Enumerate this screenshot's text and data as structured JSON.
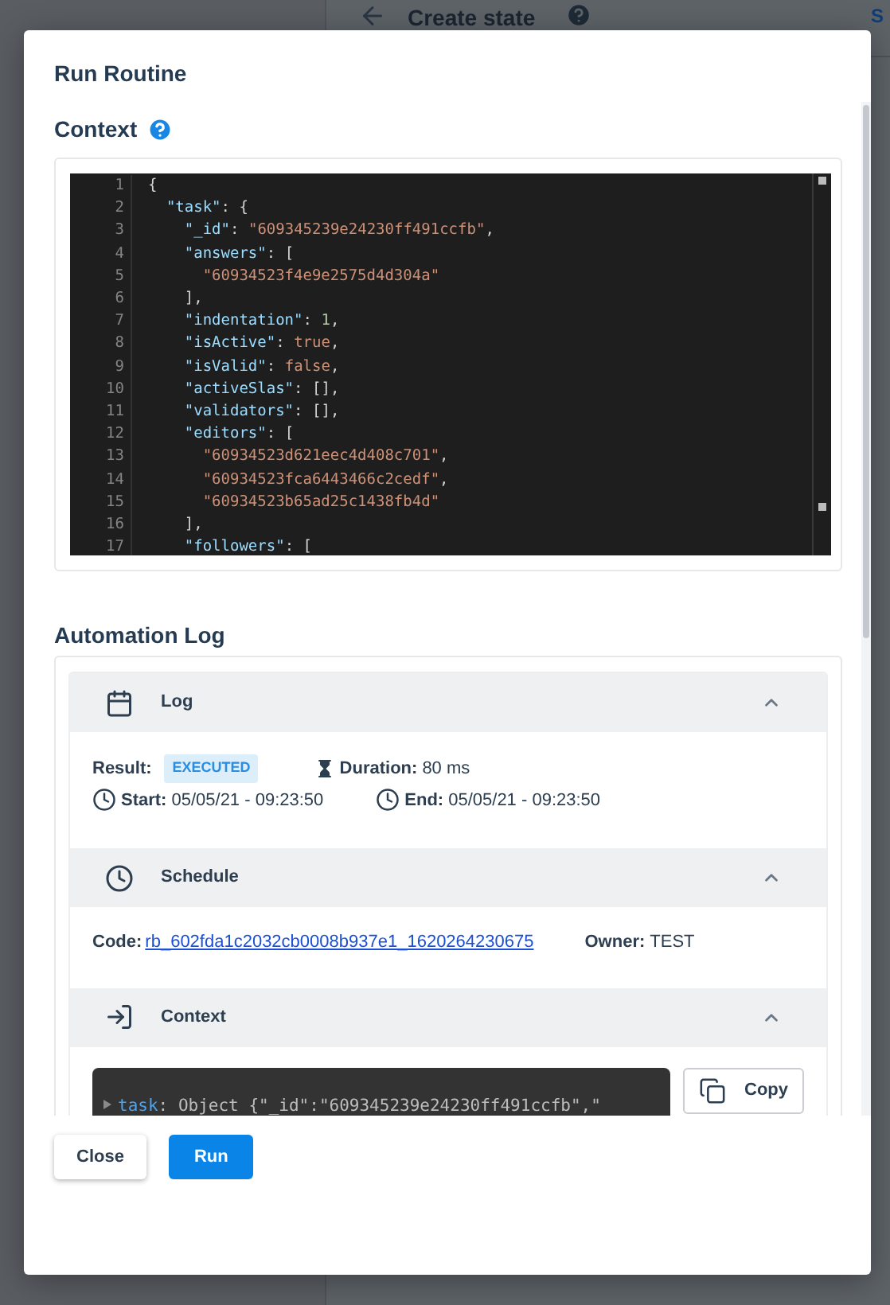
{
  "background": {
    "page_title": "Create state",
    "header_action": "S"
  },
  "dialog": {
    "title": "Run Routine",
    "context_heading": "Context",
    "code_lines": [
      {
        "number": "1",
        "text": "{"
      },
      {
        "number": "2",
        "text": "  \"task\": {"
      },
      {
        "number": "3",
        "text": "    \"_id\": \"609345239e24230ff491ccfb\","
      },
      {
        "number": "4",
        "text": "    \"answers\": ["
      },
      {
        "number": "5",
        "text": "      \"60934523f4e9e2575d4d304a\""
      },
      {
        "number": "6",
        "text": "    ],"
      },
      {
        "number": "7",
        "text": "    \"indentation\": 1,"
      },
      {
        "number": "8",
        "text": "    \"isActive\": true,"
      },
      {
        "number": "9",
        "text": "    \"isValid\": false,"
      },
      {
        "number": "10",
        "text": "    \"activeSlas\": [],"
      },
      {
        "number": "11",
        "text": "    \"validators\": [],"
      },
      {
        "number": "12",
        "text": "    \"editors\": ["
      },
      {
        "number": "13",
        "text": "      \"60934523d621eec4d408c701\","
      },
      {
        "number": "14",
        "text": "      \"60934523fca6443466c2cedf\","
      },
      {
        "number": "15",
        "text": "      \"60934523b65ad25c1438fb4d\""
      },
      {
        "number": "16",
        "text": "    ],"
      },
      {
        "number": "17",
        "text": "    \"followers\": ["
      }
    ],
    "log_heading": "Automation Log",
    "sections": [
      {
        "kind": "log",
        "title": "Log",
        "expanded": true,
        "result_label": "Result:",
        "result": "EXECUTED",
        "duration_label": "Duration:",
        "duration": "80 ms",
        "start_label": "Start:",
        "start": "05/05/21 - 09:23:50",
        "end_label": "End:",
        "end": "05/05/21 - 09:23:50"
      },
      {
        "kind": "schedule",
        "title": "Schedule",
        "expanded": true,
        "code_label": "Code:",
        "code": "rb_602fda1c2032cb0008b937e1_1620264230675",
        "owner_label": "Owner:",
        "owner": "TEST"
      },
      {
        "kind": "context",
        "title": "Context",
        "expanded": true,
        "console_key": "task",
        "console_value": ": Object {\"_id\":\"609345239e24230ff491ccfb\",\"",
        "copy_label": "Copy"
      }
    ],
    "buttons": [
      {
        "label": "Close",
        "kind": "secondary"
      },
      {
        "label": "Run",
        "kind": "primary"
      }
    ]
  }
}
